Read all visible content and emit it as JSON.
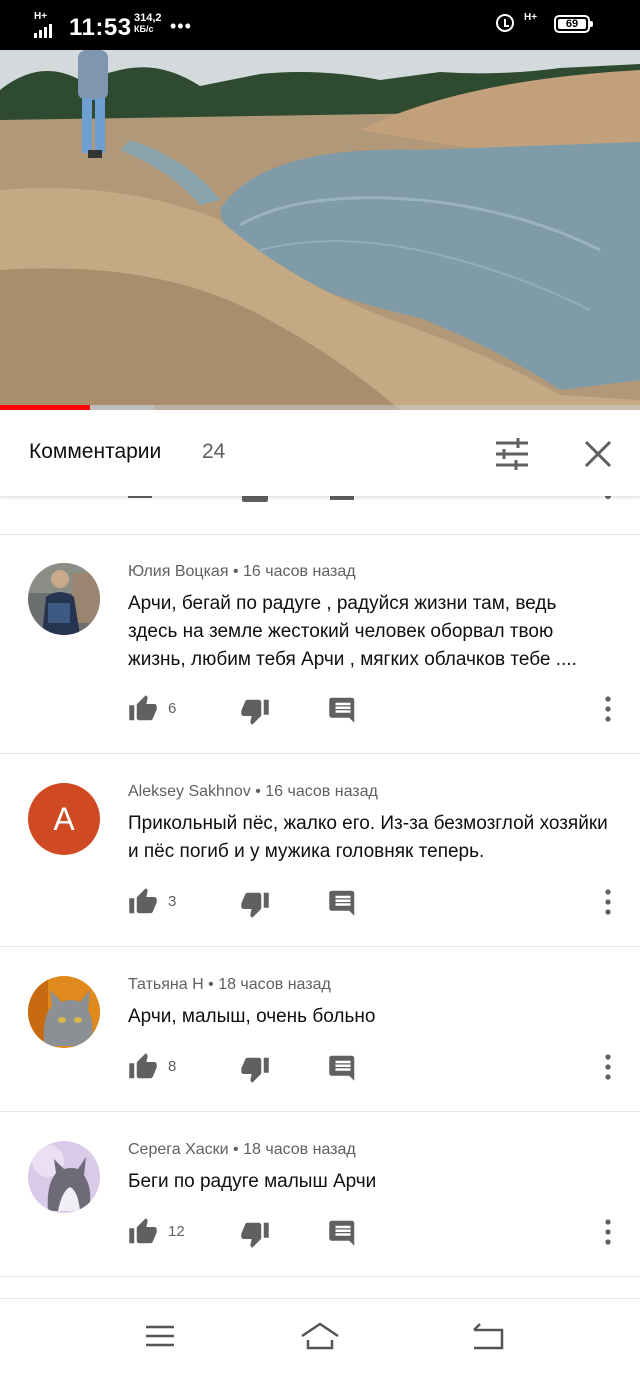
{
  "status_bar": {
    "network_left": "H+",
    "time": "11:53",
    "speed_value": "314,2",
    "speed_unit": "КБ/с",
    "dots": "•••",
    "network_right": "H+",
    "battery": "69"
  },
  "video": {
    "progress_fraction": 0.14,
    "buffered_fraction": 0.24
  },
  "comments_header": {
    "title": "Комментарии",
    "count": "24"
  },
  "comments": [
    {
      "author": "Юлия Воцкая",
      "time": "16 часов назад",
      "text": "Арчи, бегай по радуге , радуйся жизни там, ведь здесь на земле  жестокий человек оборвал твою жизнь, любим тебя Арчи , мягких облачков тебе ....",
      "likes": "6",
      "avatar_letter": ""
    },
    {
      "author": "Aleksey Sakhnov",
      "time": "16 часов назад",
      "text": "Прикольный пёс, жалко его. Из-за безмозглой хозяйки и пёс погиб и у мужика головняк теперь.",
      "likes": "3",
      "avatar_letter": "A"
    },
    {
      "author": "Татьяна Н",
      "time": "18 часов назад",
      "text": "Арчи, малыш, очень больно",
      "likes": "8",
      "avatar_letter": ""
    },
    {
      "author": "Серега Хаски",
      "time": "18 часов назад",
      "text": "Беги по радуге малыш Арчи",
      "likes": "12",
      "avatar_letter": ""
    }
  ],
  "meta_separator": "•",
  "colors": {
    "progress": "#ff0000",
    "avatar_a": "#cf4a22",
    "secondary_text": "#606060",
    "icon": "#606060"
  },
  "icons": {
    "sort": "sort-icon",
    "close": "close-icon",
    "like": "thumb-up-icon",
    "dislike": "thumb-down-icon",
    "reply": "reply-icon",
    "more": "more-vert-icon",
    "nav_menu": "menu-icon",
    "nav_home": "home-icon",
    "nav_back": "back-icon"
  }
}
